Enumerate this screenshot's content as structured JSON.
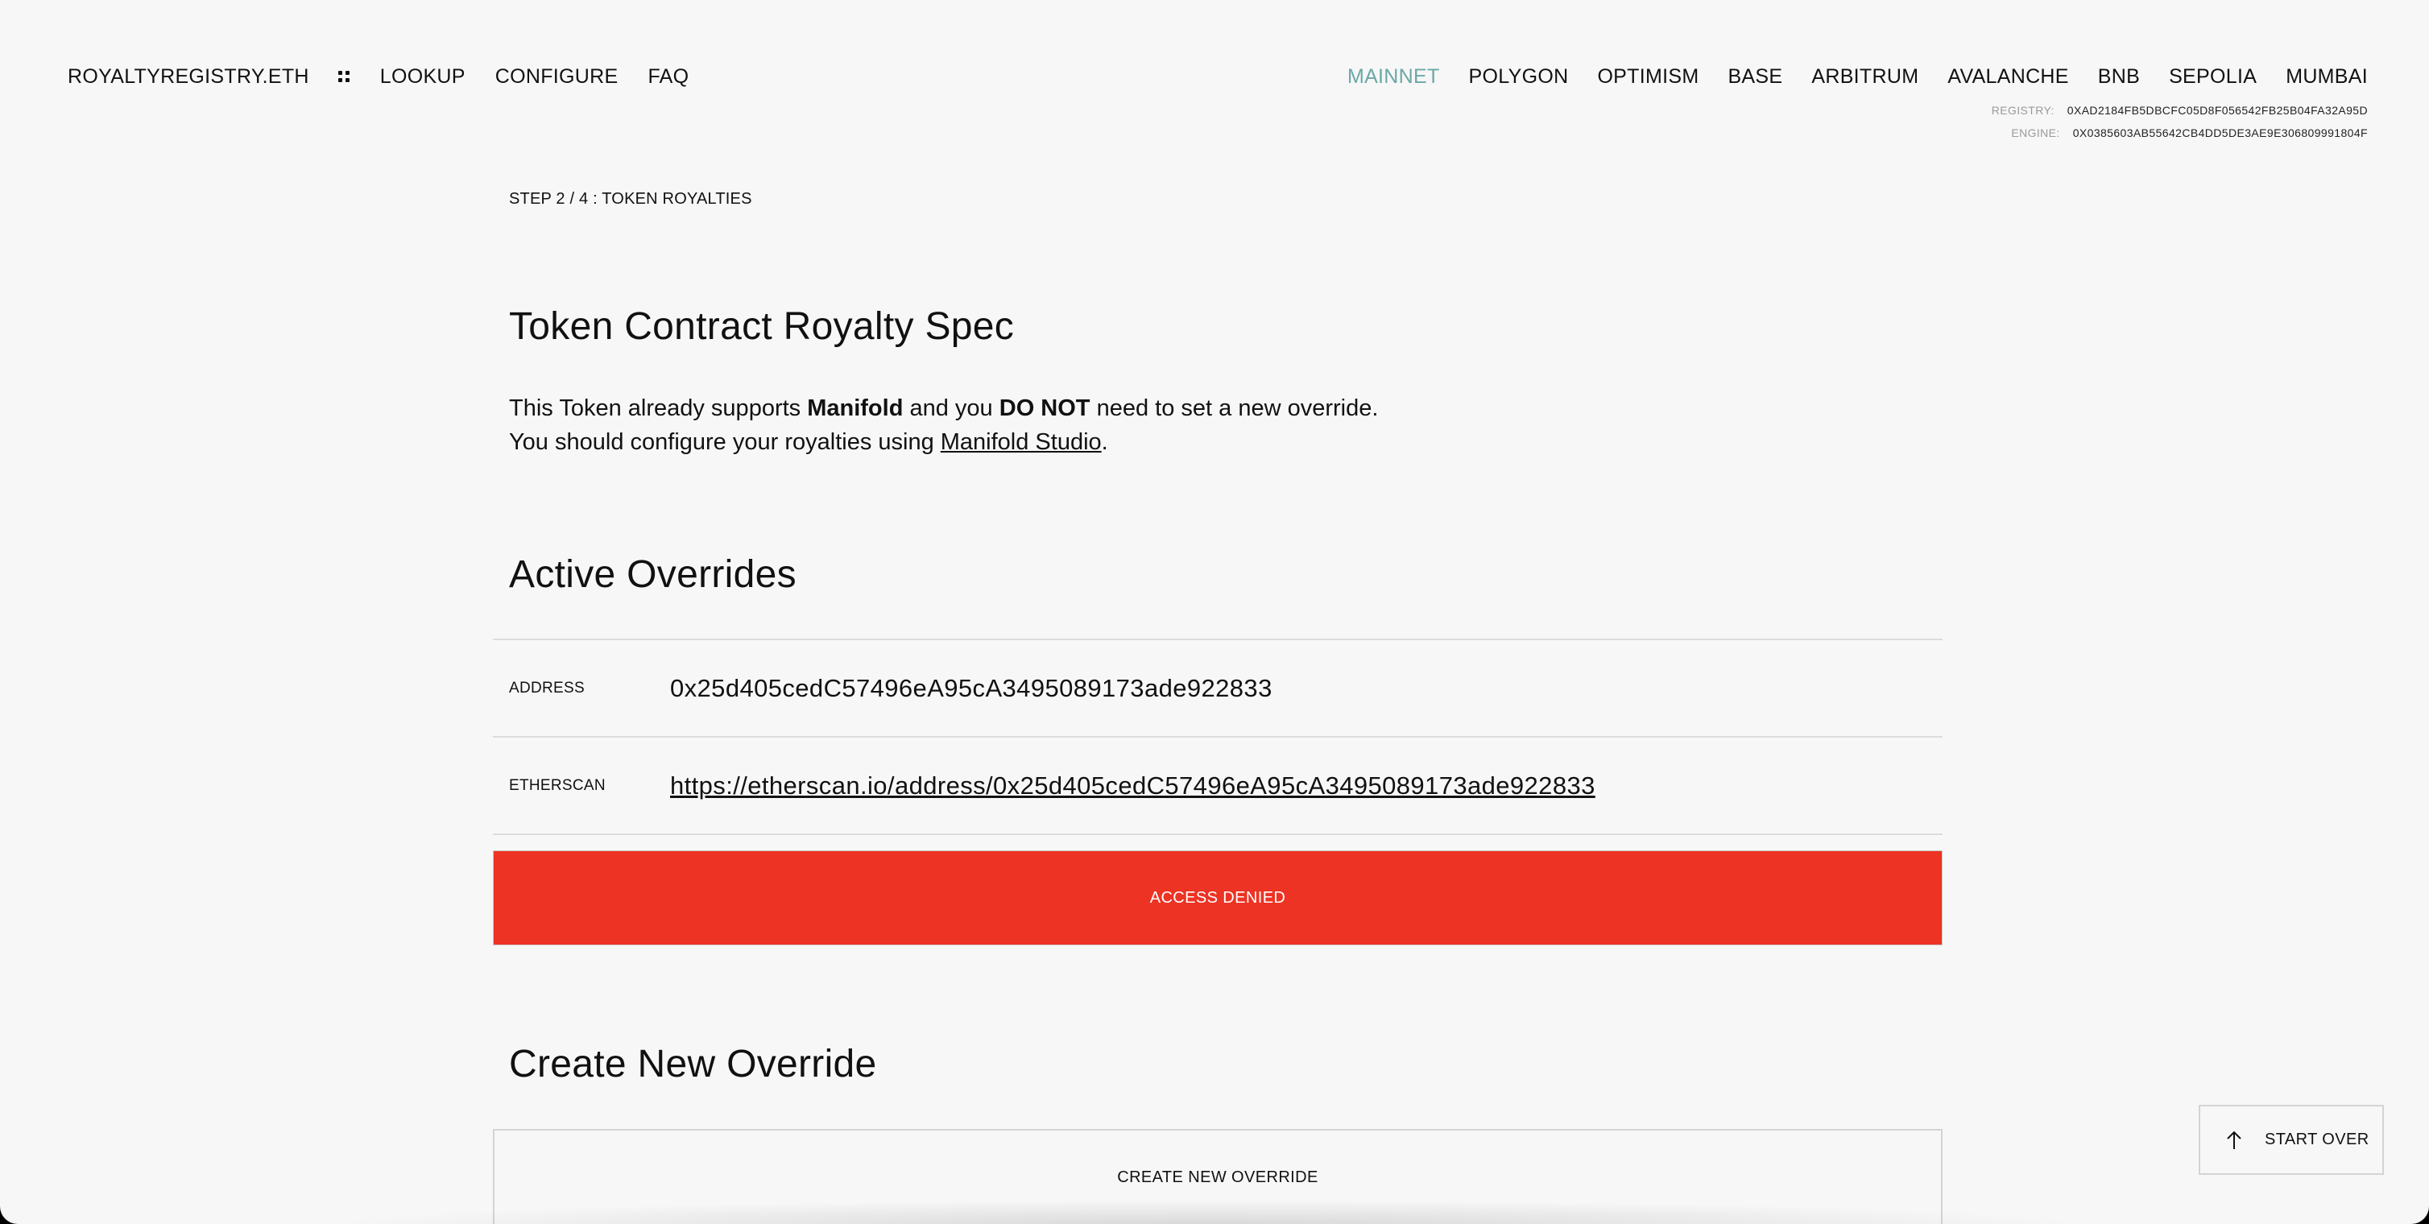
{
  "nav": {
    "brand": "ROYALTYREGISTRY.ETH",
    "links": [
      "LOOKUP",
      "CONFIGURE",
      "FAQ"
    ],
    "networks": [
      "MAINNET",
      "POLYGON",
      "OPTIMISM",
      "BASE",
      "ARBITRUM",
      "AVALANCHE",
      "BNB",
      "SEPOLIA",
      "MUMBAI"
    ],
    "active_network": "MAINNET"
  },
  "contracts": {
    "registry_label": "REGISTRY:",
    "registry_value": "0XAD2184FB5DBCFC05D8F056542FB25B04FA32A95D",
    "engine_label": "ENGINE:",
    "engine_value": "0X0385603AB55642CB4DD5DE3AE9E306809991804F"
  },
  "step": "STEP 2 / 4 : TOKEN ROYALTIES",
  "spec": {
    "title": "Token Contract Royalty Spec",
    "line1_a": "This Token already supports ",
    "line1_b": "Manifold",
    "line1_c": " and you ",
    "line1_d": "DO NOT",
    "line1_e": " need to set a new override.",
    "line2_a": "You should configure your royalties using ",
    "line2_link": "Manifold Studio",
    "line2_b": "."
  },
  "overrides": {
    "title": "Active Overrides",
    "address_label": "ADDRESS",
    "address_value": "0x25d405cedC57496eA95cA3495089173ade922833",
    "etherscan_label": "ETHERSCAN",
    "etherscan_value": "https://etherscan.io/address/0x25d405cedC57496eA95cA3495089173ade922833",
    "denied": "ACCESS DENIED",
    "denied_color": "#ec3324"
  },
  "create": {
    "title": "Create New Override",
    "button": "CREATE NEW OVERRIDE"
  },
  "start_over": {
    "label": "START OVER",
    "icon": "arrow-up-icon"
  },
  "colors": {
    "accent": "#6aa8a6",
    "background": "#f7f7f7"
  }
}
